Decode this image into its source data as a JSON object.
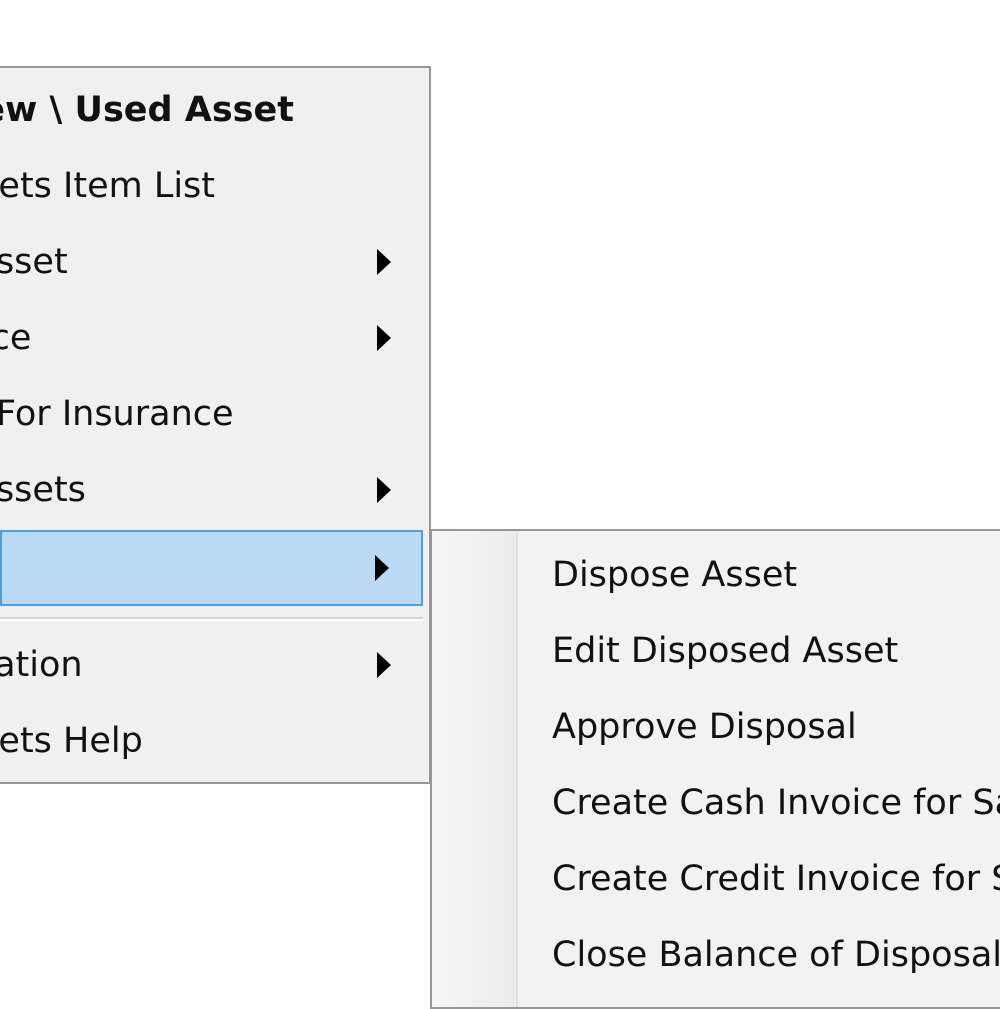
{
  "main_menu": {
    "items": [
      {
        "label": "New \\ Used Asset",
        "bold": true,
        "submenu": false
      },
      {
        "label": "Assets Item List",
        "bold": false,
        "submenu": false
      },
      {
        "label": "Asset",
        "bold": false,
        "submenu": true
      },
      {
        "label": "Price",
        "bold": false,
        "submenu": true
      },
      {
        "label": "For Insurance",
        "bold": false,
        "submenu": false
      },
      {
        "label": "Assets",
        "bold": false,
        "submenu": true
      },
      {
        "label": "",
        "bold": false,
        "submenu": true,
        "highlighted": true
      },
      {
        "label": "Information",
        "bold": false,
        "submenu": true
      },
      {
        "label": "Assets Help",
        "bold": false,
        "submenu": false
      }
    ]
  },
  "sub_menu": {
    "items": [
      {
        "label": "Dispose Asset"
      },
      {
        "label": "Edit Disposed Asset"
      },
      {
        "label": "Approve Disposal"
      },
      {
        "label": "Create Cash Invoice for Sale"
      },
      {
        "label": "Create Credit Invoice for Sale"
      },
      {
        "label": "Close Balance of Disposal Asset"
      }
    ]
  },
  "colors": {
    "highlight_fill": "#b9d9f4",
    "highlight_border": "#4d9ee8",
    "menu_background": "#f0f0f0",
    "menu_border": "#979797"
  },
  "icons": {
    "submenu_arrow": "triangle-right-icon"
  }
}
